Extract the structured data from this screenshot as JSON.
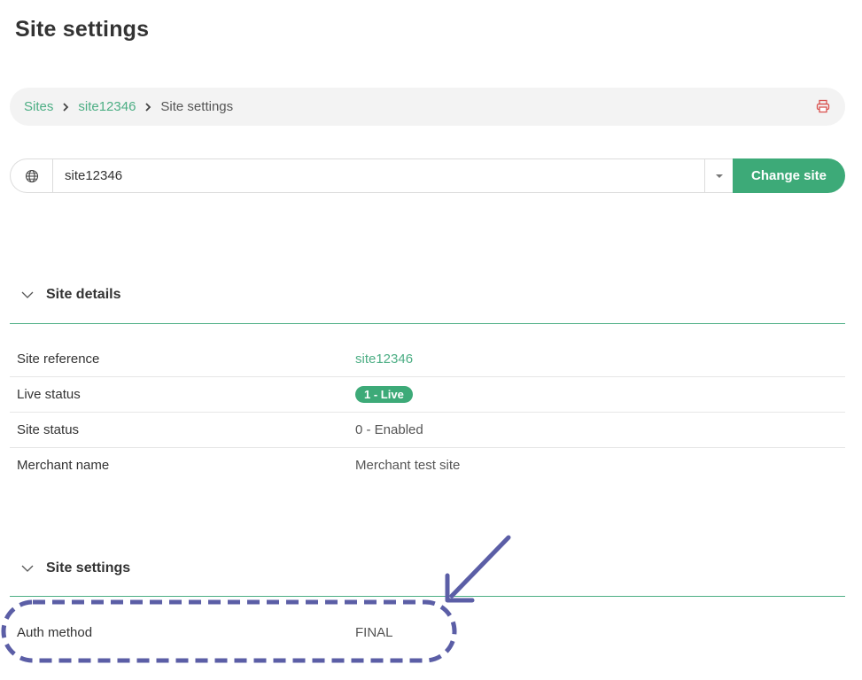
{
  "page": {
    "title": "Site settings"
  },
  "breadcrumb": {
    "items": [
      {
        "label": "Sites"
      },
      {
        "label": "site12346"
      },
      {
        "label": "Site settings"
      }
    ],
    "print_icon": "printer-icon"
  },
  "site_selector": {
    "icon": "globe-icon",
    "value": "site12346",
    "button_label": "Change site"
  },
  "site_details": {
    "title": "Site details",
    "rows": [
      {
        "label": "Site reference",
        "value": "site12346"
      },
      {
        "label": "Live status",
        "value": "1 - Live"
      },
      {
        "label": "Site status",
        "value": "0 - Enabled"
      },
      {
        "label": "Merchant name",
        "value": "Merchant test site"
      }
    ]
  },
  "site_settings": {
    "title": "Site settings",
    "rows": [
      {
        "label": "Auth method",
        "value": "FINAL"
      }
    ]
  },
  "colors": {
    "accent": "#3daa78",
    "link": "#4cae84",
    "annotation": "#5b5ea6",
    "print_icon": "#d9534f"
  }
}
